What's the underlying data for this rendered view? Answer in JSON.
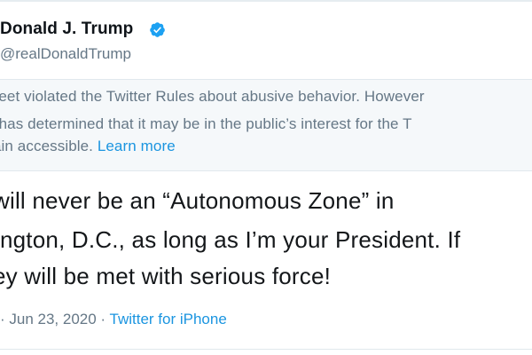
{
  "tweet": {
    "author": {
      "display_name": "Donald J. Trump",
      "handle": "@realDonaldTrump",
      "verified_icon": "verified-badge-icon"
    },
    "notice": {
      "line1": "weet violated the Twitter Rules about abusive behavior. However",
      "line2": "r has determined that it may be in the public’s interest for the T",
      "line3_text": "ain accessible. ",
      "learn_more": "Learn more"
    },
    "text": {
      "line1": "will never be an “Autonomous Zone” in",
      "line2": "ington, D.C., as long as I’m your President. If",
      "line3": "ey will be met with serious force!"
    },
    "meta": {
      "time_prefix": "· Jun 23, 2020 · ",
      "source": "Twitter for iPhone"
    }
  },
  "colors": {
    "text_primary": "#14171a",
    "text_secondary": "#657786",
    "link": "#1b95e0",
    "notice_background": "#f5f8fa",
    "verified_blue": "#1da1f2"
  }
}
